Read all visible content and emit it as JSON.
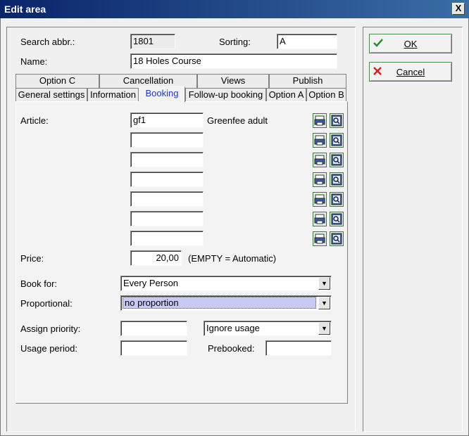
{
  "window": {
    "title": "Edit area",
    "close": "X"
  },
  "header": {
    "search_abbr_label": "Search abbr.:",
    "search_abbr_value": "1801",
    "sorting_label": "Sorting:",
    "sorting_value": "A",
    "name_label": "Name:",
    "name_value": "18 Holes Course"
  },
  "tabs": {
    "row_top": [
      "Option C",
      "Cancellation",
      "Views",
      "Publish"
    ],
    "row_bottom": [
      "General settings",
      "Information",
      "Booking",
      "Follow-up booking",
      "Option A",
      "Option B"
    ],
    "active": "Booking"
  },
  "booking": {
    "article_label": "Article:",
    "articles": [
      {
        "code": "gf1",
        "description": "Greenfee adult"
      },
      {
        "code": "",
        "description": ""
      },
      {
        "code": "",
        "description": ""
      },
      {
        "code": "",
        "description": ""
      },
      {
        "code": "",
        "description": ""
      },
      {
        "code": "",
        "description": ""
      },
      {
        "code": "",
        "description": ""
      }
    ],
    "price_label": "Price:",
    "price_value": "20,00",
    "price_hint": "(EMPTY = Automatic)",
    "book_for_label": "Book for:",
    "book_for_value": "Every Person",
    "proportional_label": "Proportional:",
    "proportional_value": "no proportion",
    "assign_priority_label": "Assign priority:",
    "assign_priority_value": "",
    "usage_select_value": "Ignore usage",
    "usage_period_label": "Usage period:",
    "usage_period_value": "",
    "prebooked_label": "Prebooked:",
    "prebooked_value": ""
  },
  "buttons": {
    "ok": "OK",
    "cancel": "Cancel"
  },
  "icons": {
    "ok": "check-icon",
    "cancel": "x-icon",
    "edit": "printer-edit-icon",
    "lookup": "magnifier-icon"
  },
  "colors": {
    "titlebar": "#0a246a",
    "active_tab_text": "#1a3acc",
    "selection": "#c9c9f5",
    "ok_check": "#2e8b2e",
    "cancel_x": "#d42020"
  }
}
